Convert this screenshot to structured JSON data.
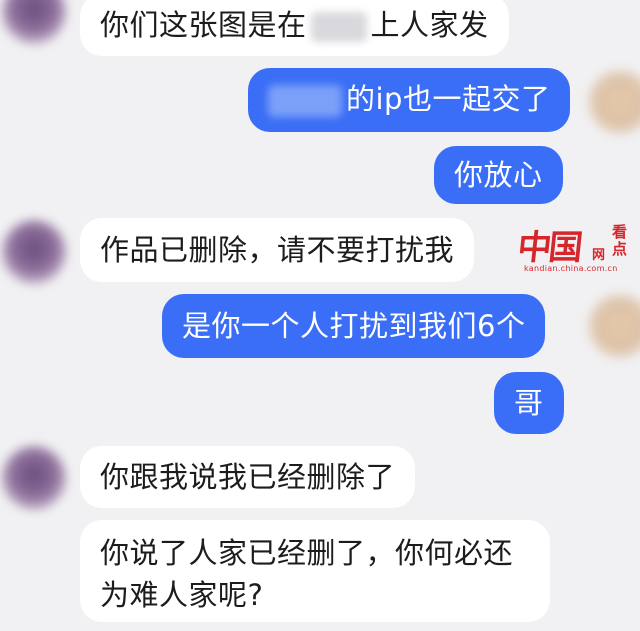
{
  "conversation": {
    "messages": [
      {
        "side": "in",
        "before": "你们这张图是在",
        "after": "上人家发"
      },
      {
        "side": "out",
        "after": "的ip也一起交了"
      },
      {
        "side": "out",
        "text": "你放心"
      },
      {
        "side": "in",
        "text": "作品已删除，请不要打扰我"
      },
      {
        "side": "out",
        "text": "是你一个人打扰到我们6个"
      },
      {
        "side": "out",
        "text": "哥"
      },
      {
        "side": "in",
        "text": "你跟我说我已经删除了"
      },
      {
        "side": "in",
        "text": "你说了人家已经删了，你何必还为难人家呢?"
      }
    ]
  },
  "watermark": {
    "logo": "中国",
    "net": "网",
    "side": "看点",
    "url": "kandian.china.com.cn"
  },
  "colors": {
    "background": "#f1f1f3",
    "incoming_bubble": "#ffffff",
    "outgoing_bubble": "#3b6ef6",
    "watermark": "#d7262b"
  }
}
